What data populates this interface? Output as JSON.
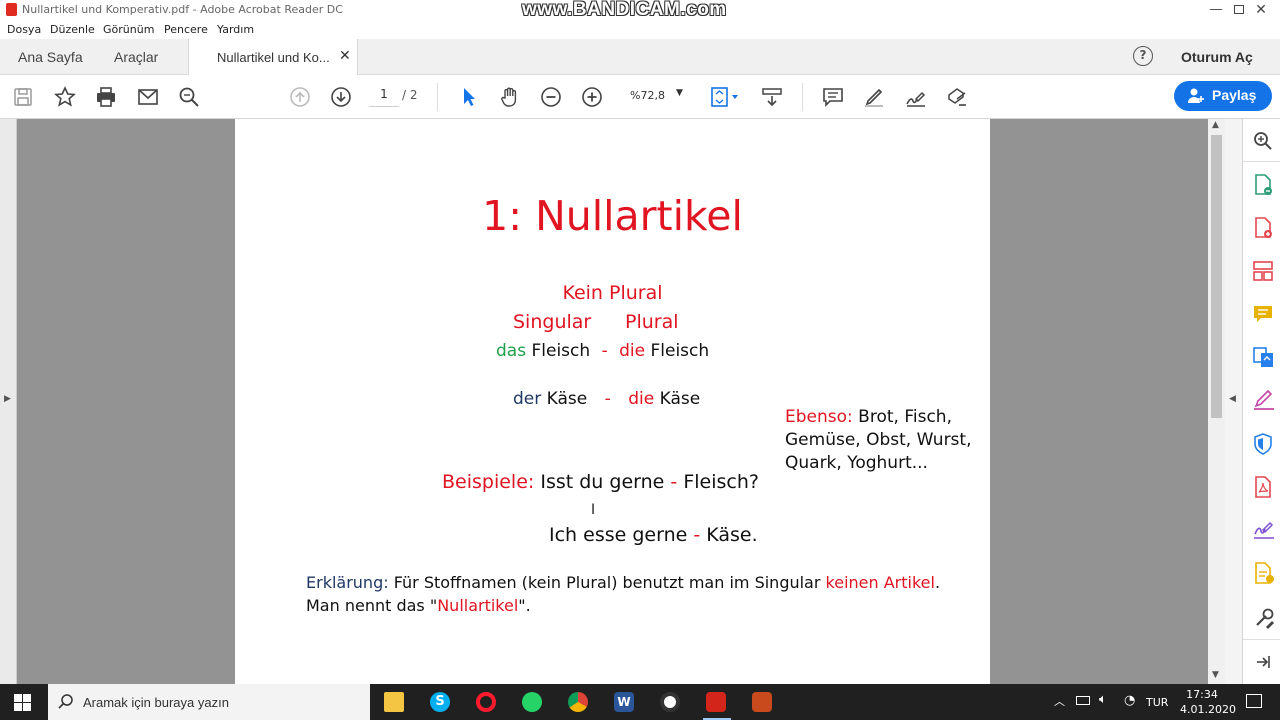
{
  "window": {
    "title": "Nullartikel und Komperativ.pdf - Adobe Acrobat Reader DC",
    "watermark": "www.BANDICAM.com"
  },
  "menu": [
    "Dosya",
    "Düzenle",
    "Görünüm",
    "Pencere",
    "Yardım"
  ],
  "tabs": {
    "home": "Ana Sayfa",
    "tools": "Araçlar",
    "document": "Nullartikel und Ko...",
    "help": "?",
    "signin": "Oturum Aç"
  },
  "toolbar": {
    "page_current": "1",
    "page_total": "/ 2",
    "zoom": "%72,8",
    "share_label": "Paylaş"
  },
  "pdf": {
    "title": "1: Nullartikel",
    "kein_plural": "Kein Plural",
    "singular": "Singular",
    "plural": "Plural",
    "row1": {
      "art1": "das",
      "noun1": "Fleisch",
      "dash": "-",
      "art2": "die",
      "noun2": "Fleisch"
    },
    "row2": {
      "art1": "der",
      "noun1": "Käse",
      "dash": "-",
      "art2": "die",
      "noun2": "Käse"
    },
    "ebenso_label": "Ebenso:",
    "ebenso_line1": "Brot, Fisch,",
    "ebenso_line2": "Gemüse, Obst, Wurst,",
    "ebenso_line3": "Quark, Yoghurt...",
    "beispiele_label": "Beispiele:",
    "example1_a": "Isst du gerne",
    "example1_dash": "-",
    "example1_b": "Fleisch?",
    "example2_a": "Ich esse gerne",
    "example2_dash": "-",
    "example2_b": "Käse.",
    "erk_label": "Erklärung:",
    "erk_text1": "Für Stoffnamen (kein Plural) benutzt man im Singular",
    "erk_red1": "keinen",
    "erk_red2": "Artikel",
    "erk_text2": ". Man nennt das \"",
    "erk_red3": "Nullartikel",
    "erk_text3": "\"."
  },
  "taskbar": {
    "search_placeholder": "Aramak için buraya yazın",
    "language": "TUR",
    "time": "17:34",
    "date": "4.01.2020"
  },
  "colors": {
    "accent": "#1473e6",
    "pdf_red": "#e11421",
    "pdf_green": "#20a04a",
    "pdf_navy": "#1f3864",
    "workspace": "#939393"
  }
}
